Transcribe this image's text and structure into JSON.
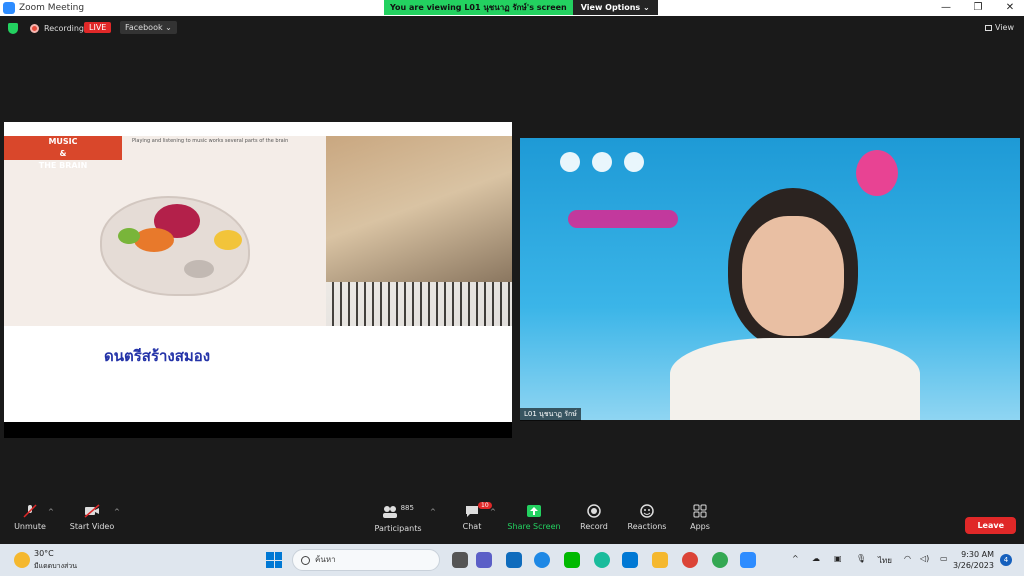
{
  "window": {
    "title": "Zoom Meeting"
  },
  "banner": {
    "viewing": "You are viewing L01 นุชนาฏ รักษ์'s screen",
    "view_options": "View Options ⌄"
  },
  "topbar": {
    "recording": "Recording",
    "live": "LIVE",
    "stream_target": "Facebook ⌄",
    "view": "View"
  },
  "slide": {
    "brain_title": "MUSIC\n&\nTHE BRAIN",
    "brain_subtitle": "Playing and listening to music works several parts of the brain",
    "caption": "ดนตรีสร้างสมอง"
  },
  "speaker": {
    "name_tag": "L01 นุชนาฏ รักษ์"
  },
  "toolbar": {
    "unmute": "Unmute",
    "start_video": "Start Video",
    "participants": "Participants",
    "participants_count": "885",
    "chat": "Chat",
    "chat_badge": "10",
    "share_screen": "Share Screen",
    "record": "Record",
    "reactions": "Reactions",
    "apps": "Apps",
    "leave": "Leave"
  },
  "taskbar": {
    "temp": "30°C",
    "weather": "มีแดดบางส่วน",
    "search": "ค้นหา",
    "lang": "ไทย",
    "time": "9:30 AM",
    "date": "3/26/2023",
    "notifications": "4"
  },
  "colors": {
    "share_green": "#23d160",
    "live_red": "#e02828",
    "zoom_blue": "#2d8cff"
  }
}
